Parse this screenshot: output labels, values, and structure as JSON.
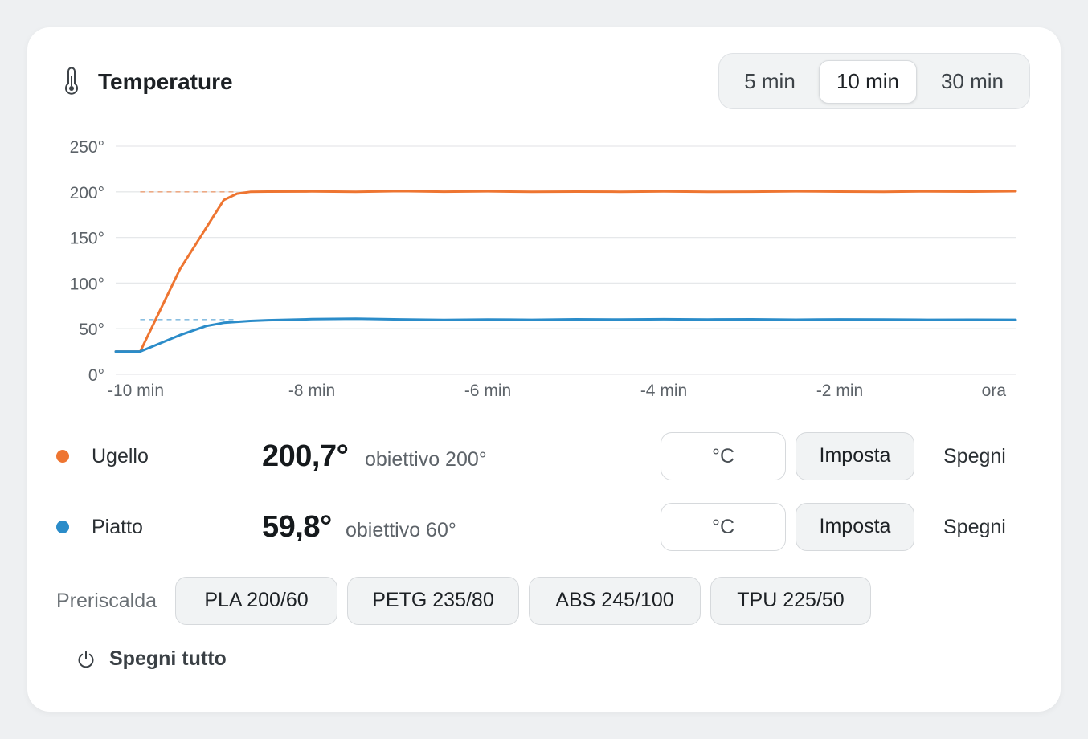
{
  "card": {
    "title": "Temperature",
    "title_icon": "thermometer-icon"
  },
  "time_range": {
    "options": [
      "5 min",
      "10 min",
      "30 min"
    ],
    "selected": "10 min"
  },
  "chart_data": {
    "type": "line",
    "x_unit": "min",
    "xlim": [
      -10,
      0
    ],
    "ylim": [
      0,
      250
    ],
    "y_ticks": [
      "250°",
      "200°",
      "150°",
      "100°",
      "50°",
      "0°"
    ],
    "x_ticks": [
      "-10 min",
      "-8 min",
      "-6 min",
      "-4 min",
      "-2 min",
      "ora"
    ],
    "x_tick_values": [
      -10,
      -8,
      -6,
      -4,
      -2,
      0
    ],
    "grid": true,
    "series": [
      {
        "color": "#ee7531",
        "target": 200,
        "x": [
          -10.3,
          -9.95,
          -9.5,
          -9.0,
          -8.85,
          -8.7,
          -8.5,
          -8.0,
          -7.5,
          -7.0,
          -6.5,
          -6.0,
          -5.5,
          -5.0,
          -4.5,
          -4.0,
          -3.5,
          -3.0,
          -2.5,
          -2.0,
          -1.5,
          -1.0,
          -0.5,
          0.0
        ],
        "y": [
          25,
          25,
          115,
          191,
          198,
          200,
          200.3,
          200.4,
          200,
          200.8,
          200.2,
          200.6,
          200,
          200.3,
          200.1,
          200.4,
          200,
          200.2,
          200.6,
          200.3,
          200.1,
          200.5,
          200.3,
          200.7
        ]
      },
      {
        "color": "#2b8cc9",
        "target": 60,
        "x": [
          -10.3,
          -9.95,
          -9.5,
          -9.2,
          -9.0,
          -8.7,
          -8.5,
          -8.0,
          -7.5,
          -7.0,
          -6.5,
          -6.0,
          -5.5,
          -5.0,
          -4.5,
          -4.0,
          -3.5,
          -3.0,
          -2.5,
          -2.0,
          -1.5,
          -1.0,
          -0.5,
          0.0
        ],
        "y": [
          25,
          25,
          43,
          53,
          56.5,
          58.5,
          59.3,
          60.5,
          61,
          60.2,
          59.6,
          60.1,
          59.8,
          60.3,
          60,
          60.4,
          60.1,
          60.3,
          59.9,
          60.2,
          60.1,
          59.8,
          59.9,
          59.8
        ]
      }
    ]
  },
  "heaters": [
    {
      "name": "Ugello",
      "color": "#ee7531",
      "value": "200,7°",
      "target_text": "obiettivo 200°",
      "input_placeholder": "°C",
      "set_label": "Imposta",
      "off_label": "Spegni"
    },
    {
      "name": "Piatto",
      "color": "#2b8cc9",
      "value": "59,8°",
      "target_text": "obiettivo 60°",
      "input_placeholder": "°C",
      "set_label": "Imposta",
      "off_label": "Spegni"
    }
  ],
  "preheat": {
    "label": "Preriscalda",
    "presets": [
      "PLA 200/60",
      "PETG 235/80",
      "ABS 245/100",
      "TPU 225/50"
    ]
  },
  "all_off": {
    "label": "Spegni tutto",
    "icon": "power-icon"
  }
}
